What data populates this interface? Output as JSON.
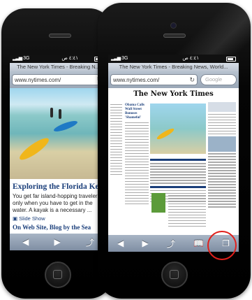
{
  "status_bar": {
    "carrier": "3G",
    "time": "٤:٤١ ص"
  },
  "safari": {
    "page_title": "The New York Times - Breaking N...",
    "page_title_front": "The New York Times - Breaking News, World...",
    "url": "www.nytimes.com/",
    "search_placeholder": "Google"
  },
  "back_page": {
    "headline": "Exploring the Florida Keys by K",
    "body": "You get far island-hopping travelers only when you have to get in the water. A kayak is a necessary ...",
    "slideshow_label": "Slide Show",
    "next_headline": "On Web Site, Blog by the Sea"
  },
  "front_page": {
    "masthead": "The New York Times",
    "lead_headline": "Obama Calls Wall Street Bonuses 'Shameful'"
  },
  "toolbar": {
    "back": "◀",
    "forward": "▶",
    "share": "⤴",
    "bookmarks": "📖",
    "pages": "❐"
  },
  "colors": {
    "highlight_circle": "#e0201c",
    "nyt_link_blue": "#1a3e7a"
  }
}
